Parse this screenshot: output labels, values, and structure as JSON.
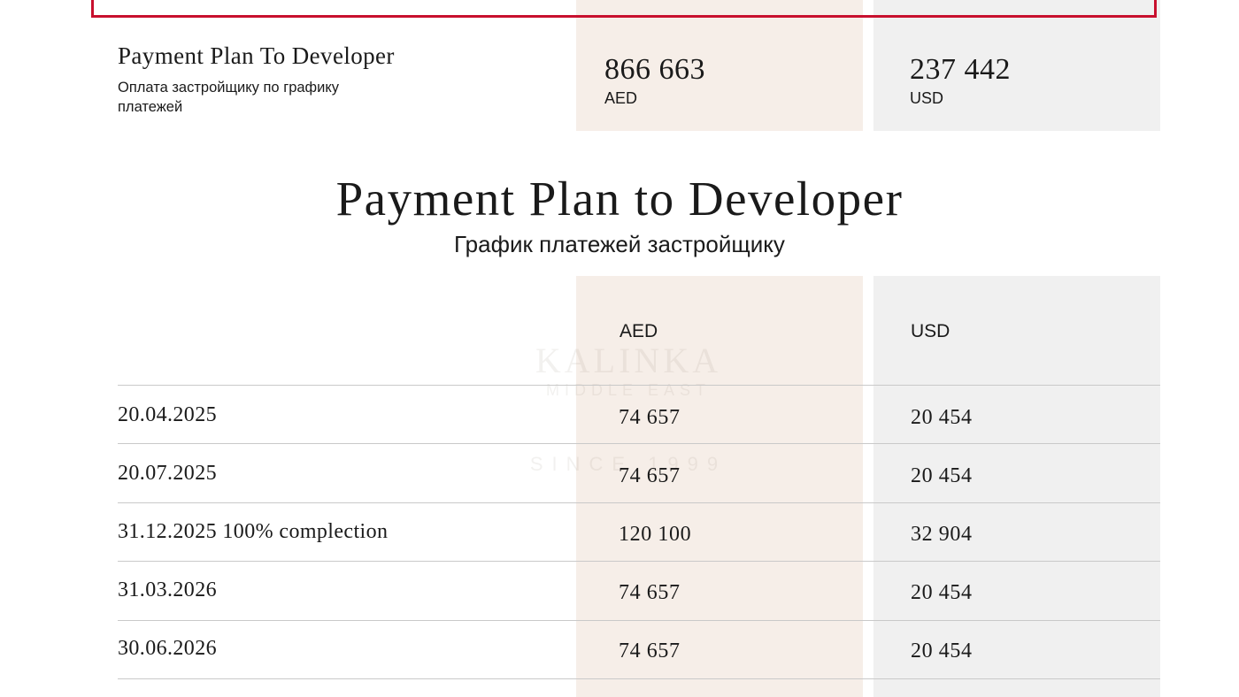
{
  "summary": {
    "title": "Payment Plan To Developer",
    "subtitle": "Оплата застройщику по графику платежей",
    "aed_amount": "866 663",
    "aed_currency": "AED",
    "usd_amount": "237 442",
    "usd_currency": "USD"
  },
  "schedule": {
    "title": "Payment Plan to Developer",
    "subtitle": "График платежей застройщику",
    "headers": {
      "aed": "AED",
      "usd": "USD"
    },
    "rows": [
      {
        "date": "20.04.2025",
        "aed": "74 657",
        "usd": "20 454"
      },
      {
        "date": "20.07.2025",
        "aed": "74 657",
        "usd": "20 454"
      },
      {
        "date": "31.12.2025 100% complection",
        "aed": "120 100",
        "usd": "32 904"
      },
      {
        "date": "31.03.2026",
        "aed": "74 657",
        "usd": "20 454"
      },
      {
        "date": "30.06.2026",
        "aed": "74 657",
        "usd": "20 454"
      }
    ]
  },
  "watermark": {
    "brand": "KALINKA",
    "tagline": "MIDDLE EAST",
    "since": "SINCE 1999"
  },
  "colors": {
    "frame_red": "#c8102e",
    "aed_column": "#f6eee8",
    "usd_column": "#f0f0f0"
  }
}
